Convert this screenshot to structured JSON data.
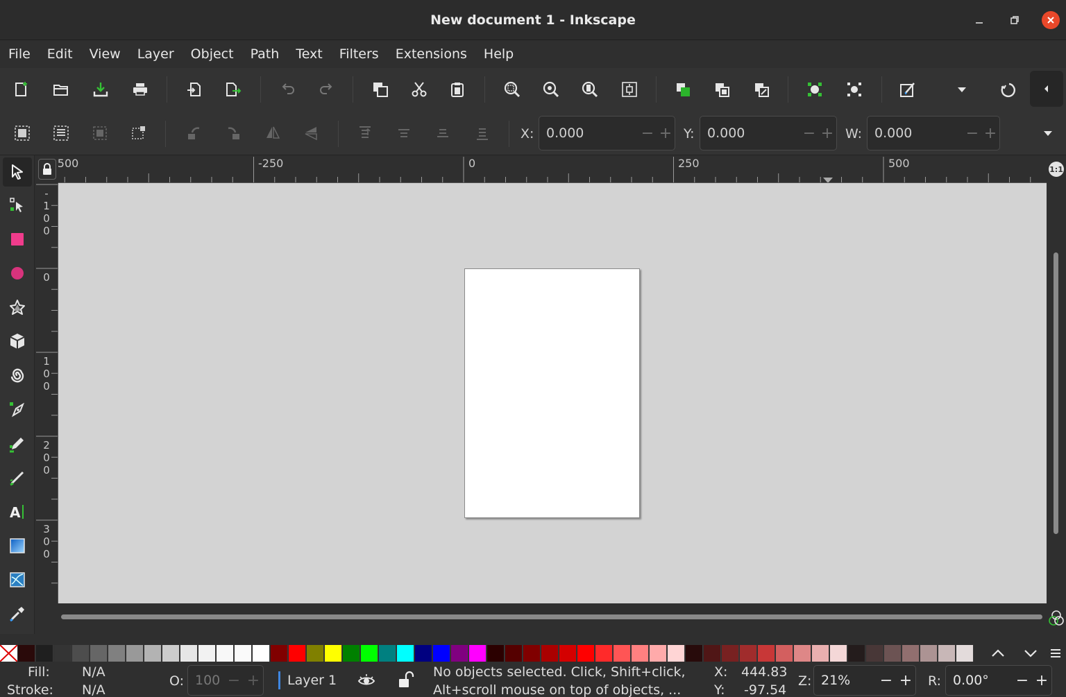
{
  "window": {
    "title": "New document 1 - Inkscape"
  },
  "menu": [
    "File",
    "Edit",
    "View",
    "Layer",
    "Object",
    "Path",
    "Text",
    "Filters",
    "Extensions",
    "Help"
  ],
  "controls": {
    "x_label": "X:",
    "x_value": "0.000",
    "y_label": "Y:",
    "y_value": "0.000",
    "w_label": "W:",
    "w_value": "0.000",
    "minus": "−",
    "plus": "+"
  },
  "rulers": {
    "horizontal": [
      "-500",
      "-250",
      "0",
      "250",
      "500"
    ],
    "vertical": [
      "-100",
      "0",
      "100",
      "200",
      "300"
    ],
    "zoom_1to1": "1:1"
  },
  "palette": {
    "colors": [
      "#2a0a0a",
      "#1f1f1f",
      "#343434",
      "#4d4d4d",
      "#666666",
      "#808080",
      "#999999",
      "#b3b3b3",
      "#cccccc",
      "#e6e6e6",
      "#f2f2f2",
      "#f8f8f8",
      "#fafafa",
      "#ffffff",
      "#800000",
      "#ff0000",
      "#808000",
      "#ffff00",
      "#008000",
      "#00ff00",
      "#008080",
      "#00ffff",
      "#000080",
      "#0000ff",
      "#800080",
      "#ff00ff",
      "#2b0000",
      "#550000",
      "#800000",
      "#aa0000",
      "#d40000",
      "#ff0000",
      "#ff2a2a",
      "#ff5555",
      "#ff8080",
      "#ffaaaa",
      "#ffd5d5",
      "#280b0b",
      "#501616",
      "#782121",
      "#a02c2c",
      "#c83737",
      "#d35f5f",
      "#de8787",
      "#e9afaf",
      "#f4d7d7",
      "#241c1c",
      "#483737",
      "#6c5353",
      "#916f6f",
      "#ac9393",
      "#c8b7b7",
      "#e3dbdb"
    ]
  },
  "status": {
    "fill_label": "Fill:",
    "fill_value": "N/A",
    "stroke_label": "Stroke:",
    "stroke_value": "N/A",
    "opacity_label": "O:",
    "opacity_value": "100",
    "layer": "Layer 1",
    "message_line1": "No objects selected. Click, Shift+click,",
    "message_line2": "Alt+scroll mouse on top of objects, ...",
    "cursor_x_label": "X:",
    "cursor_x": "444.83",
    "cursor_y_label": "Y:",
    "cursor_y": "-97.54",
    "zoom_label": "Z:",
    "zoom_value": "21%",
    "rotate_label": "R:",
    "rotate_value": "0.00°"
  }
}
